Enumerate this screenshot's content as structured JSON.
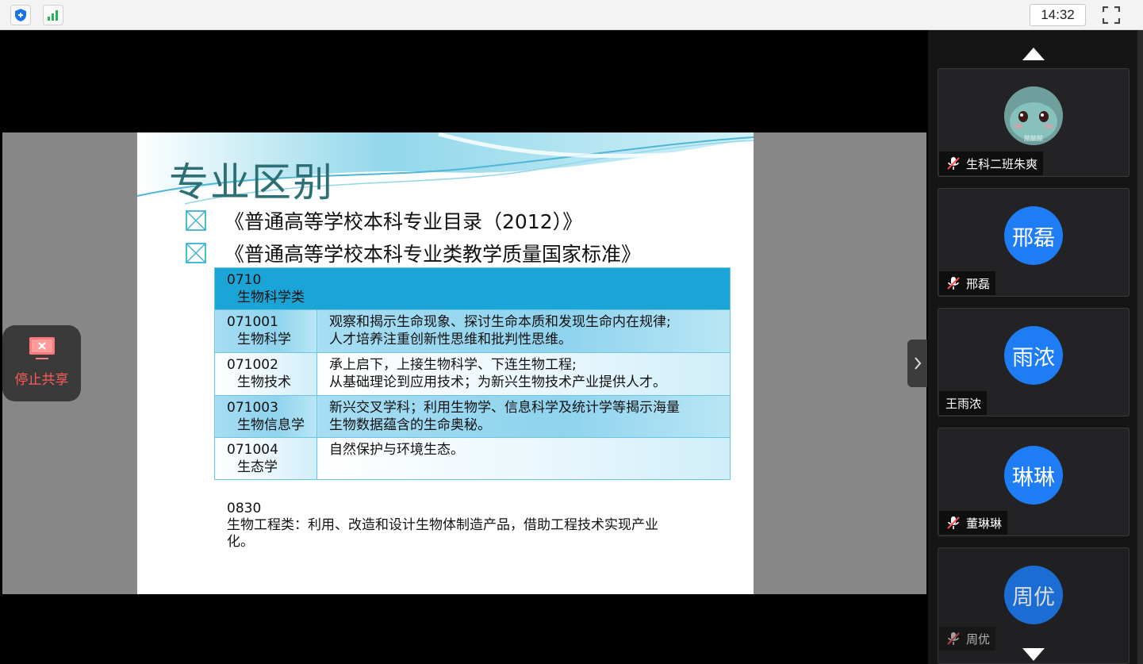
{
  "topbar": {
    "clock": "14:32",
    "shield_icon": "shield-plus-icon",
    "signal_icon": "signal-bars-icon",
    "fullscreen_icon": "fullscreen-icon"
  },
  "slide": {
    "title": "专业区别",
    "bullets": [
      "《普通高等学校本科专业目录（2012）》",
      "《普通高等学校本科专业类教学质量国家标准》"
    ],
    "table": {
      "header_code": "0710",
      "header_name": "生物科学类",
      "rows": [
        {
          "code": "071001",
          "name": "生物科学",
          "desc1": "观察和揭示生命现象、探讨生命本质和发现生命内在规律;",
          "desc2": "人才培养注重创新性思维和批判性思维。"
        },
        {
          "code": "071002",
          "name": "生物技术",
          "desc1": "承上启下，上接生物科学、下连生物工程;",
          "desc2": "从基础理论到应用技术；为新兴生物技术产业提供人才。"
        },
        {
          "code": "071003",
          "name": "生物信息学",
          "desc1": "新兴交叉学科；利用生物学、信息科学及统计学等揭示海量",
          "desc2": "生物数据蕴含的生命奥秘。"
        },
        {
          "code": "071004",
          "name": "生态学",
          "desc1": "自然保护与环境生态。",
          "desc2": ""
        }
      ]
    },
    "bio_eng_code": "0830",
    "bio_eng_line1": "生物工程类：利用、改造和设计生物体制造产品，借助工程技术实现产业",
    "bio_eng_line2": "化。"
  },
  "stop_share": {
    "label": "停止共享",
    "icon": "stop-share-monitor-icon"
  },
  "participants": [
    {
      "name": "生科二班朱爽",
      "avatar": "",
      "muted": true,
      "avatar_text": "脓脓脓"
    },
    {
      "name": "邢磊",
      "avatar": "邢磊",
      "muted": true
    },
    {
      "name": "王雨浓",
      "avatar": "雨浓",
      "muted": false
    },
    {
      "name": "董琳琳",
      "avatar": "琳琳",
      "muted": true
    },
    {
      "name": "周优",
      "avatar": "周优",
      "muted": true
    }
  ],
  "colors": {
    "avatar_blue": "#1e7df5",
    "stop_red": "#ff5a5a",
    "table_header": "#1aa5d6",
    "title_teal": "#2c6f74"
  }
}
